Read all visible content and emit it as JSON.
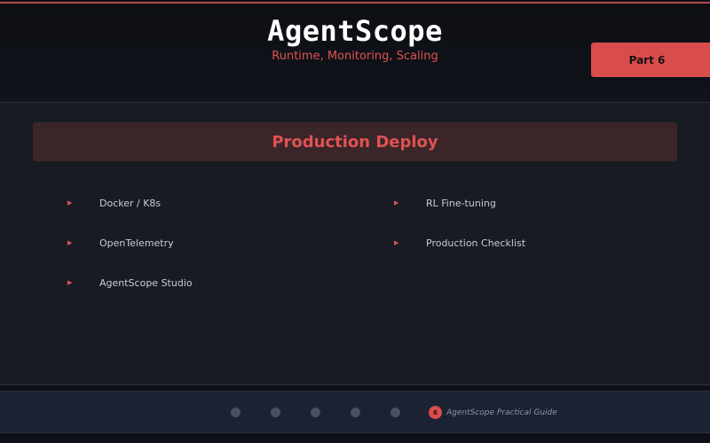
{
  "header": {
    "title": "AgentScope",
    "subtitle": "Runtime, Monitoring, Scaling",
    "part_badge": "Part 6"
  },
  "section": {
    "title": "Production Deploy"
  },
  "topics": [
    {
      "label": "Docker / K8s"
    },
    {
      "label": "OpenTelemetry"
    },
    {
      "label": "AgentScope Studio"
    },
    {
      "label": "RL Fine-tuning"
    },
    {
      "label": "Production Checklist"
    }
  ],
  "bullet_icon": "triangle-right-icon",
  "footer": {
    "active_page": "6",
    "guide_label": "AgentScope Practical Guide",
    "page_dots": 5
  },
  "colors": {
    "accent": "#d94c4c",
    "background": "#181b22",
    "footer": "#1b2232",
    "banner": "#3a2628"
  }
}
